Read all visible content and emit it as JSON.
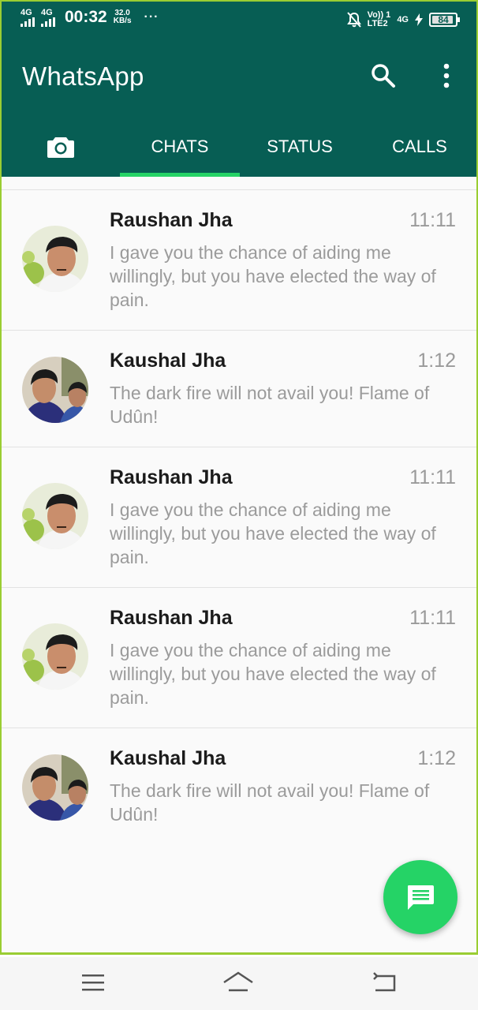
{
  "status_bar": {
    "signal1": "4G",
    "signal2": "4G",
    "time": "00:32",
    "speed_value": "32.0",
    "speed_unit": "KB/s",
    "overflow": "···",
    "volte_top": "Vo)) 1",
    "volte_bottom": "LTE2",
    "net": "4G",
    "battery": "84"
  },
  "app_bar": {
    "title": "WhatsApp",
    "search_icon": "search-icon",
    "menu_icon": "more-vert-icon"
  },
  "tabs": {
    "camera_icon": "camera-icon",
    "items": [
      "CHATS",
      "STATUS",
      "CALLS"
    ],
    "active": "CHATS"
  },
  "chats": [
    {
      "name": "Raushan Jha",
      "time": "11:11",
      "message": "I gave you the chance of aiding me willingly, but you have elected the way of pain."
    },
    {
      "name": "Kaushal Jha",
      "time": "1:12",
      "message": "The dark fire will not avail you! Flame of Udûn!"
    },
    {
      "name": "Raushan Jha",
      "time": "11:11",
      "message": "I gave you the chance of aiding me willingly, but you have elected the way of pain."
    },
    {
      "name": "Raushan Jha",
      "time": "11:11",
      "message": "I gave you the chance of aiding me willingly, but you have elected the way of pain."
    },
    {
      "name": "Kaushal Jha",
      "time": "1:12",
      "message": "The dark fire will not avail you! Flame of Udûn!"
    }
  ],
  "fab_icon": "new-chat-icon",
  "nav_bar": {
    "menu_icon": "menu-icon",
    "home_icon": "home-icon",
    "back_icon": "back-icon"
  },
  "colors": {
    "primary": "#075e54",
    "accent": "#25d366",
    "frame_border": "#9acd32"
  }
}
